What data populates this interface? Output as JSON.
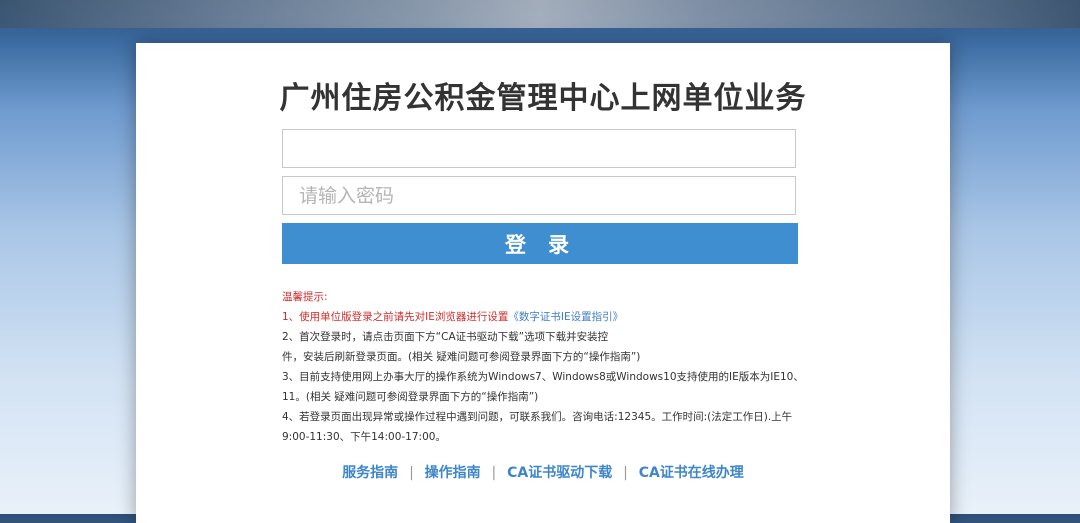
{
  "page": {
    "title": "广州住房公积金管理中心上网单位业务"
  },
  "login_form": {
    "username_value": "",
    "password_placeholder": "请输入密码",
    "login_button": "登录"
  },
  "tips": {
    "heading": "温馨提示:",
    "item1_text": "1、使用单位版登录之前请先对IE浏览器进行设置",
    "item1_link": "《数字证书IE设置指引》",
    "item2_line1": "2、首次登录时，请点击页面下方“CA证书驱动下载”选项下载并安装控",
    "item2_line2": "件，安装后刷新登录页面。(相关 疑难问题可参阅登录界面下方的“操作指南”)",
    "item3_line1": "3、目前支持使用网上办事大厅的操作系统为Windows7、Windows8或Windows10支持使用的IE版本为IE10、",
    "item3_line2": "11。(相关 疑难问题可参阅登录界面下方的“操作指南”)",
    "item4_line1": "4、若登录页面出现异常或操作过程中遇到问题，可联系我们。咨询电话:12345。工作时间:(法定工作日).上午",
    "item4_line2": "9:00-11:30、下午14:00-17:00。"
  },
  "footer_links": [
    {
      "label": "服务指南"
    },
    {
      "label": "操作指南"
    },
    {
      "label": "CA证书驱动下载"
    },
    {
      "label": "CA证书在线办理"
    }
  ],
  "footer_separator": "|",
  "colors": {
    "accent": "#3e8ed0",
    "warning": "#d12c2c",
    "link": "#3e7cc4"
  }
}
